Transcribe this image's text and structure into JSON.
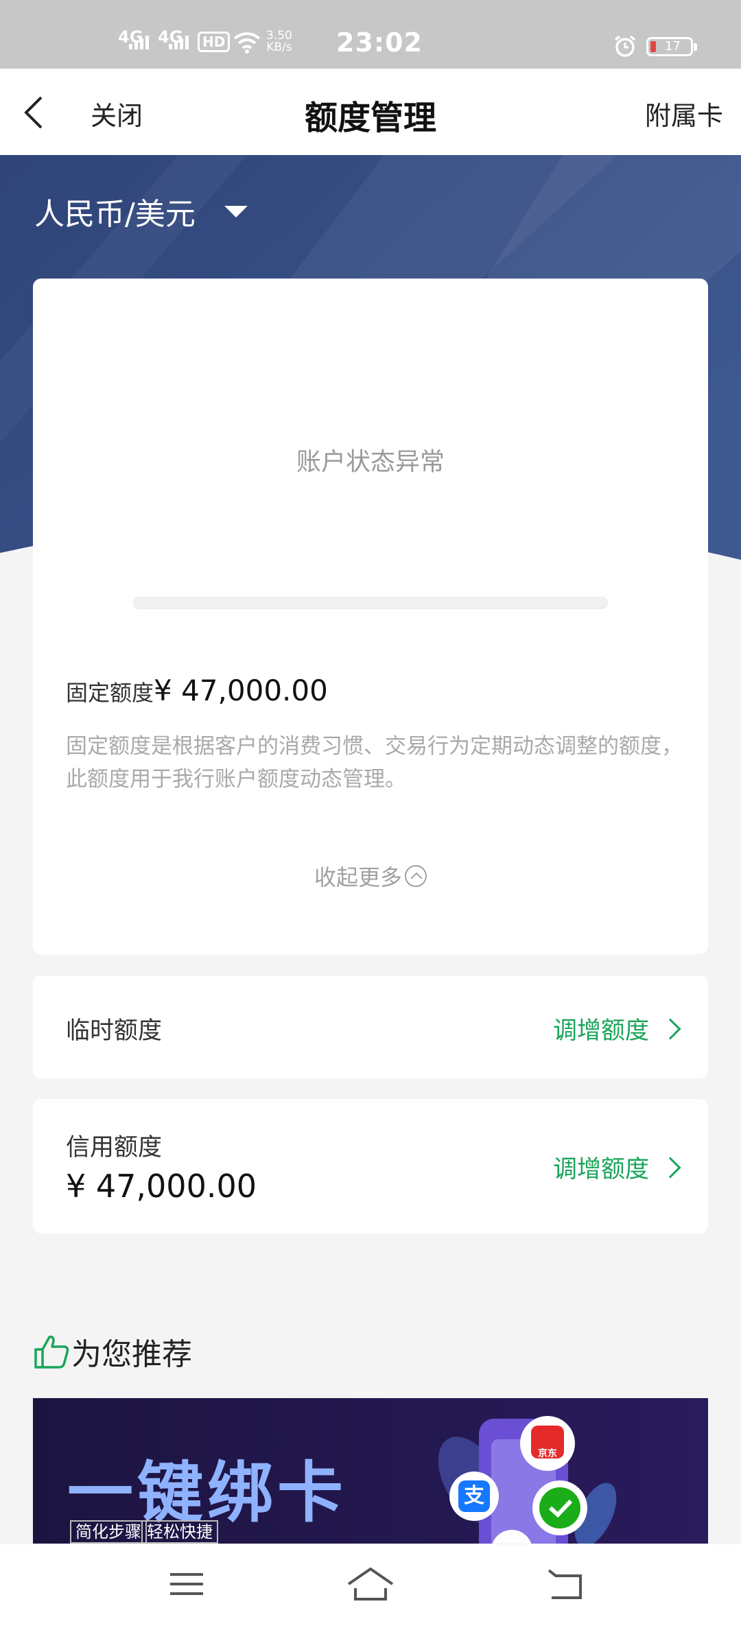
{
  "status_bar": {
    "network_1": "4G",
    "network_2": "4G",
    "hd_badge": "HD",
    "speed_value": "3.50",
    "speed_unit": "KB/s",
    "time": "23:02",
    "battery": "17"
  },
  "nav": {
    "back_icon": "chevron-left-icon",
    "close_label": "关闭",
    "title": "额度管理",
    "right_label": "附属卡"
  },
  "header": {
    "currency_label": "人民币/美元",
    "dropdown_icon": "caret-down-icon",
    "bg_color": "#344a7c"
  },
  "main_card": {
    "status_text": "账户状态异常",
    "fixed_label": "固定额度",
    "fixed_amount": "¥ 47,000.00",
    "fixed_desc": "固定额度是根据客户的消费习惯、交易行为定期动态调整的额度，此额度用于我行账户额度动态管理。",
    "collapse_label": "收起更多"
  },
  "temp_limit": {
    "label": "临时额度",
    "action": "调增额度"
  },
  "credit_limit": {
    "label": "信用额度",
    "amount": "¥ 47,000.00",
    "action": "调增额度"
  },
  "recommend": {
    "icon": "thumbs-up-icon",
    "title": "为您推荐"
  },
  "banner": {
    "title": "一键绑卡",
    "tag_1": "简化步骤",
    "tag_2": "轻松快捷",
    "jd_label": "京东",
    "alipay_glyph": "支"
  },
  "bottom_nav": {
    "icons": [
      "menu-icon",
      "home-icon",
      "back-icon"
    ]
  },
  "colors": {
    "accent_green": "#1aa55a",
    "header_blue": "#344a7c"
  }
}
